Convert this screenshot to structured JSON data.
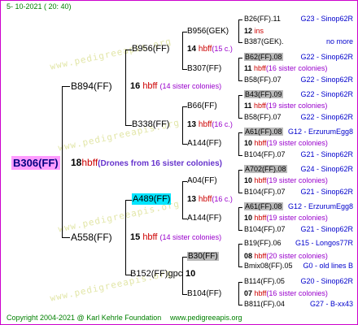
{
  "header": {
    "date": "5- 10-2021 ( 20: 40)"
  },
  "footer": {
    "copyright": "Copyright 2004-2021 @ Karl Kehrle Foundation",
    "site": "www.pedigreeapis.org"
  },
  "root": {
    "id": "B306(FF)",
    "gen": "18",
    "type": "hbff",
    "note": "(Drones from 16 sister colonies)"
  },
  "gen1": {
    "top": {
      "id": "B894(FF)",
      "gen": "16",
      "type": "hbff",
      "note": "(14 sister colonies)"
    },
    "bottom": {
      "id": "A558(FF)",
      "gen": "15",
      "type": "hbff",
      "note": "(14 sister colonies)"
    }
  },
  "gen2": {
    "a": {
      "id": "B956(FF)",
      "gen": "14",
      "type": "hbff",
      "note": "(15 c.)"
    },
    "b": {
      "id": "B338(FF)",
      "gen": "13",
      "type": "hbff",
      "note": "(16 c.)"
    },
    "c": {
      "id": "A489(FF)",
      "gen": "13",
      "type": "hbff",
      "note": "(16 c.)"
    },
    "d": {
      "id": "B152(FF)gpc",
      "gen": "10"
    }
  },
  "gen3": {
    "a": {
      "id": "B956(GEK)",
      "gen": "12",
      "type": "ins"
    },
    "b": {
      "id": "B307(FF)",
      "gen": "11",
      "type": "hbff",
      "note": "(16 sister colonies)"
    },
    "c": {
      "id": "B66(FF)",
      "gen": "11",
      "type": "hbff",
      "note": "(19 sister colonies)"
    },
    "d": {
      "id": "A144(FF)",
      "gen": "10",
      "type": "hbff",
      "note": "(19 sister colonies)"
    },
    "e": {
      "id": "A04(FF)",
      "gen": "10",
      "type": "hbff",
      "note": "(19 sister colonies)"
    },
    "f": {
      "id": "A144(FF)",
      "gen": "10",
      "type": "hbff",
      "note": "(19 sister colonies)"
    },
    "g": {
      "id": "B30(FF)",
      "gen": "08",
      "type": "hbff",
      "note": "(20 sister colonies)"
    },
    "h": {
      "id": "B104(FF)",
      "gen": "07",
      "type": "hbff",
      "note": "(16 sister colonies)"
    }
  },
  "gen4": [
    {
      "id": "B26(FF).11",
      "loc": "G23 - Sinop62R"
    },
    {
      "id": "B387(GEK).",
      "loc": "no more"
    },
    {
      "id": "B62(FF).08",
      "loc": "G22 - Sinop62R"
    },
    {
      "id": "B58(FF).07",
      "loc": "G22 - Sinop62R"
    },
    {
      "id": "B43(FF).09",
      "loc": "G22 - Sinop62R"
    },
    {
      "id": "B58(FF).07",
      "loc": "G22 - Sinop62R"
    },
    {
      "id": "A61(FF).08",
      "loc": "G12 - ErzurumEgg8"
    },
    {
      "id": "B104(FF).07",
      "loc": "G21 - Sinop62R"
    },
    {
      "id": "A702(FF).08",
      "loc": "G24 - Sinop62R"
    },
    {
      "id": "B104(FF).07",
      "loc": "G21 - Sinop62R"
    },
    {
      "id": "A61(FF).08",
      "loc": "G12 - ErzurumEgg8"
    },
    {
      "id": "B104(FF).07",
      "loc": "G21 - Sinop62R"
    },
    {
      "id": "B19(FF).06",
      "loc": "G15 - Longos77R"
    },
    {
      "id": "Bmix08(FF).05",
      "loc": "G0 - old lines B"
    },
    {
      "id": "B114(FF).05",
      "loc": "G20 - Sinop62R"
    },
    {
      "id": "B811(FF).04",
      "loc": "G27 - B-xx43"
    }
  ],
  "watermark": "www.pedigreeapis.org"
}
